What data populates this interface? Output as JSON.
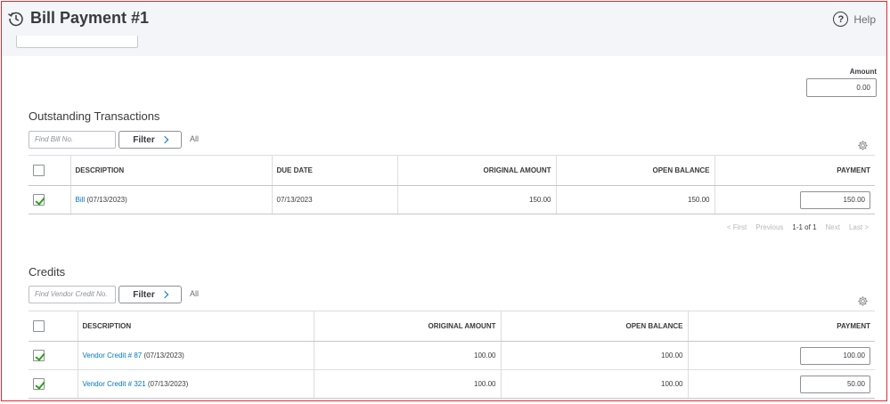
{
  "header": {
    "title": "Bill Payment #1",
    "help_label": "Help"
  },
  "amount": {
    "label": "Amount",
    "value": "0.00"
  },
  "outstanding": {
    "title": "Outstanding Transactions",
    "search_placeholder": "Find Bill No.",
    "filter_label": "Filter",
    "all_label": "All",
    "columns": {
      "description": "DESCRIPTION",
      "due_date": "DUE DATE",
      "original_amount": "ORIGINAL AMOUNT",
      "open_balance": "OPEN BALANCE",
      "payment": "PAYMENT"
    },
    "rows": [
      {
        "checked": true,
        "link": "Bill",
        "desc_suffix": " (07/13/2023)",
        "due_date": "07/13/2023",
        "original_amount": "150.00",
        "open_balance": "150.00",
        "payment": "150.00"
      }
    ],
    "pager": {
      "first": "< First",
      "previous": "Previous",
      "range": "1-1 of 1",
      "next": "Next",
      "last": "Last >"
    }
  },
  "credits": {
    "title": "Credits",
    "search_placeholder": "Find Vendor Credit No.",
    "filter_label": "Filter",
    "all_label": "All",
    "columns": {
      "description": "DESCRIPTION",
      "original_amount": "ORIGINAL AMOUNT",
      "open_balance": "OPEN BALANCE",
      "payment": "PAYMENT"
    },
    "rows": [
      {
        "checked": true,
        "link": "Vendor Credit # 87",
        "desc_suffix": " (07/13/2023)",
        "original_amount": "100.00",
        "open_balance": "100.00",
        "payment": "100.00"
      },
      {
        "checked": true,
        "link": "Vendor Credit # 321",
        "desc_suffix": " (07/13/2023)",
        "original_amount": "100.00",
        "open_balance": "100.00",
        "payment": "50.00"
      }
    ]
  },
  "colors": {
    "accent": "#0077c5",
    "check": "#2ca01c",
    "frame": "#e8262d"
  }
}
